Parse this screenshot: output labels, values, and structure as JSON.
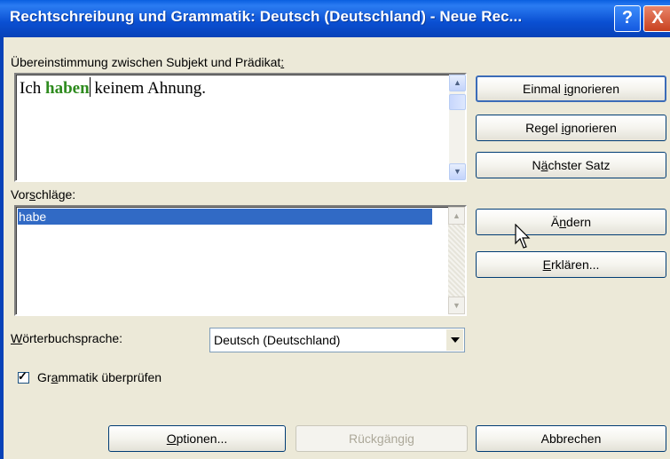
{
  "window": {
    "title": "Rechtschreibung und Grammatik: Deutsch (Deutschland) - Neue Rec...",
    "help_label": "?",
    "close_label": "X"
  },
  "error_section": {
    "label_text": "Übereinstimmung zwischen Subjekt und Prädikat",
    "label_colon": ":",
    "sentence_before": "Ich ",
    "sentence_error": "haben",
    "sentence_after": " keinem Ahnung."
  },
  "suggestions": {
    "label_pre": "Vor",
    "label_accel": "s",
    "label_post": "chläge:",
    "items": [
      "habe"
    ]
  },
  "dictionary": {
    "label_accel": "W",
    "label_post": "örterbuchsprache:",
    "selected": "Deutsch (Deutschland)"
  },
  "grammar_check": {
    "label_pre": "Gr",
    "label_accel": "a",
    "label_post": "mmatik überprüfen",
    "checked": true,
    "check_glyph": "✓"
  },
  "buttons": {
    "ignore_once": {
      "pre": "Einmal ",
      "accel": "i",
      "post": "gnorieren"
    },
    "ignore_rule": {
      "pre": "Regel ",
      "accel": "i",
      "post": "gnorieren"
    },
    "next_sentence": {
      "pre": "N",
      "accel": "ä",
      "post": "chster Satz"
    },
    "change": {
      "pre": "Ä",
      "accel": "n",
      "post": "dern"
    },
    "explain": {
      "pre": "",
      "accel": "E",
      "post": "rklären..."
    },
    "options": {
      "pre": "",
      "accel": "O",
      "post": "ptionen..."
    },
    "undo": {
      "label": "Rückgängig"
    },
    "cancel": {
      "label": "Abbrechen"
    }
  },
  "icons": {
    "scroll_up": "▲",
    "scroll_down": "▼"
  }
}
